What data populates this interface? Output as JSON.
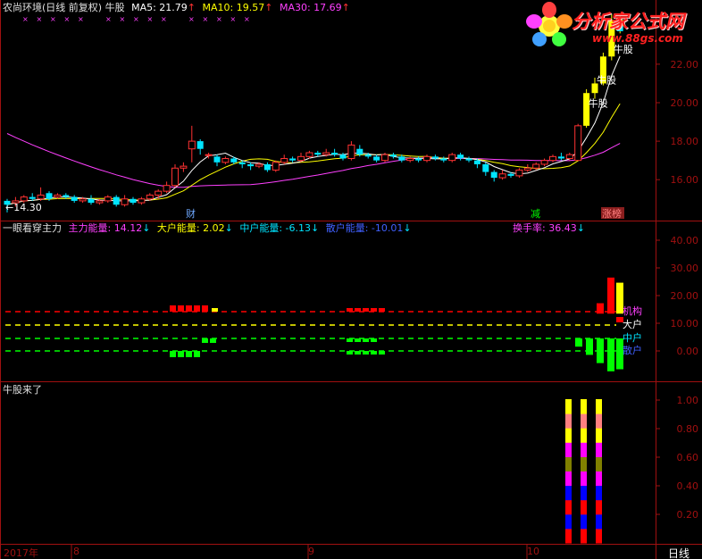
{
  "header": {
    "title": "农尚环境(日线 前复权) 牛股",
    "ma5": "MA5: 21.79",
    "ma10": "MA10: 19.57",
    "ma30": "MA30: 17.69",
    "arrow_up": "↑"
  },
  "indicator_header": {
    "name": "一眼看穿主力",
    "main": "主力能量: 14.12",
    "big": "大户能量: 2.02",
    "mid": "中户能量: -6.13",
    "retail": "散户能量: -10.01",
    "turnover": "换手率: 36.43",
    "arrow_down": "↓"
  },
  "signal_header": {
    "name": "牛股来了"
  },
  "logo": {
    "text": "分析家公式网",
    "url": "www.88gs.com"
  },
  "period_label": "日线",
  "time_axis": [
    {
      "label": "2017年"
    },
    {
      "label": "8"
    },
    {
      "label": "9"
    },
    {
      "label": "10"
    }
  ],
  "event_labels": [
    {
      "text": "财",
      "color": "#6fa8ff"
    },
    {
      "text": "减",
      "color": "#00ff00"
    },
    {
      "text": "涨榜",
      "color": "#ff8080",
      "bg": "#8a1e1e"
    }
  ],
  "price_labels": {
    "low_marker": "←14.30",
    "bull": "牛股"
  },
  "colors": {
    "up": "#ff3232",
    "down": "#00e4ff",
    "ma5": "#ffffff",
    "ma10": "#ffff00",
    "ma30": "#ff40ff",
    "axis": "#a01010",
    "bull_bar": "#ffff00"
  },
  "chart_data": [
    {
      "type": "candlestick",
      "title": "农尚环境(日线 前复权) 牛股",
      "ylim": [
        14.2,
        24.5
      ],
      "yticks": [
        "16.00",
        "18.00",
        "20.00",
        "22.00"
      ],
      "series": [
        {
          "name": "MA5",
          "value": 21.79
        },
        {
          "name": "MA10",
          "value": 19.57
        },
        {
          "name": "MA30",
          "value": 17.69
        }
      ],
      "candles": [
        [
          14.9,
          14.7,
          15.0,
          14.3
        ],
        [
          14.8,
          14.9,
          15.1,
          14.6
        ],
        [
          14.9,
          15.1,
          15.2,
          14.8
        ],
        [
          15.1,
          15.0,
          15.3,
          14.9
        ],
        [
          15.0,
          15.2,
          15.6,
          14.9
        ],
        [
          15.3,
          15.0,
          15.4,
          14.9
        ],
        [
          15.1,
          15.2,
          15.3,
          15.0
        ],
        [
          15.2,
          15.1,
          15.3,
          15.0
        ],
        [
          15.1,
          14.9,
          15.2,
          14.8
        ],
        [
          14.9,
          15.0,
          15.1,
          14.8
        ],
        [
          15.0,
          14.8,
          15.2,
          14.7
        ],
        [
          14.8,
          14.9,
          15.0,
          14.7
        ],
        [
          14.9,
          15.1,
          15.2,
          14.8
        ],
        [
          15.1,
          14.7,
          15.2,
          14.6
        ],
        [
          14.7,
          15.0,
          15.2,
          14.6
        ],
        [
          15.0,
          14.8,
          15.1,
          14.7
        ],
        [
          14.8,
          15.0,
          15.1,
          14.7
        ],
        [
          15.0,
          15.2,
          15.3,
          14.9
        ],
        [
          15.2,
          15.4,
          15.5,
          15.0
        ],
        [
          15.4,
          15.7,
          15.9,
          15.3
        ],
        [
          15.7,
          16.6,
          16.8,
          15.6
        ],
        [
          16.6,
          16.7,
          16.9,
          16.4
        ],
        [
          17.6,
          18.0,
          18.8,
          16.9
        ],
        [
          18.0,
          17.6,
          18.1,
          17.3
        ],
        [
          17.3,
          17.3,
          17.4,
          17.1
        ],
        [
          17.2,
          16.9,
          17.3,
          16.7
        ],
        [
          16.9,
          17.1,
          17.2,
          16.8
        ],
        [
          17.1,
          16.9,
          17.2,
          16.8
        ],
        [
          16.9,
          16.8,
          17.0,
          16.6
        ],
        [
          16.8,
          16.7,
          16.9,
          16.5
        ],
        [
          16.7,
          16.8,
          16.9,
          16.6
        ],
        [
          16.8,
          16.5,
          16.9,
          16.4
        ],
        [
          16.5,
          16.9,
          17.0,
          16.4
        ],
        [
          16.9,
          17.1,
          17.3,
          16.8
        ],
        [
          17.1,
          17.0,
          17.2,
          16.9
        ],
        [
          17.0,
          17.2,
          17.4,
          16.9
        ],
        [
          17.2,
          17.4,
          17.5,
          17.1
        ],
        [
          17.4,
          17.3,
          17.5,
          17.2
        ],
        [
          17.3,
          17.4,
          17.6,
          17.2
        ],
        [
          17.4,
          17.3,
          17.6,
          17.2
        ],
        [
          17.3,
          17.1,
          17.4,
          17.0
        ],
        [
          17.1,
          17.8,
          18.0,
          17.0
        ],
        [
          17.6,
          17.3,
          17.8,
          17.2
        ],
        [
          17.3,
          17.2,
          17.4,
          17.1
        ],
        [
          17.2,
          17.0,
          17.3,
          16.9
        ],
        [
          17.0,
          17.3,
          17.4,
          16.9
        ],
        [
          17.3,
          17.2,
          17.4,
          17.1
        ],
        [
          17.2,
          17.0,
          17.3,
          16.9
        ],
        [
          17.0,
          17.1,
          17.2,
          16.9
        ],
        [
          17.1,
          17.0,
          17.2,
          16.9
        ],
        [
          17.0,
          17.2,
          17.3,
          16.9
        ],
        [
          17.2,
          17.1,
          17.3,
          17.0
        ],
        [
          17.1,
          17.0,
          17.2,
          16.9
        ],
        [
          17.0,
          17.3,
          17.4,
          16.9
        ],
        [
          17.3,
          17.1,
          17.4,
          17.0
        ],
        [
          17.1,
          17.0,
          17.2,
          16.9
        ],
        [
          17.0,
          16.8,
          17.1,
          16.6
        ],
        [
          16.8,
          16.4,
          16.9,
          16.2
        ],
        [
          16.4,
          16.1,
          16.5,
          15.9
        ],
        [
          16.1,
          16.3,
          16.5,
          16.0
        ],
        [
          16.3,
          16.2,
          16.4,
          16.1
        ],
        [
          16.2,
          16.5,
          16.6,
          16.1
        ],
        [
          16.5,
          16.6,
          16.8,
          16.4
        ],
        [
          16.6,
          16.8,
          16.9,
          16.5
        ],
        [
          16.8,
          17.0,
          17.1,
          16.7
        ],
        [
          17.0,
          17.2,
          17.3,
          16.9
        ],
        [
          17.2,
          17.1,
          17.4,
          17.0
        ],
        [
          17.1,
          17.3,
          17.4,
          17.0
        ],
        [
          17.0,
          18.8,
          18.9,
          17.0
        ],
        [
          18.8,
          20.5,
          20.7,
          18.7
        ],
        [
          20.5,
          21.0,
          21.3,
          20.2
        ],
        [
          21.0,
          22.4,
          22.6,
          20.9
        ],
        [
          22.4,
          24.3,
          24.6,
          22.2
        ],
        [
          24.3,
          23.9,
          24.6,
          23.6
        ]
      ]
    },
    {
      "type": "bar",
      "title": "一眼看穿主力",
      "ylim": [
        -10,
        45
      ],
      "yticks": [
        "0.00",
        "10.00",
        "20.00",
        "30.00",
        "40.00"
      ],
      "series": [
        {
          "name": "主力能量",
          "value": 14.12
        },
        {
          "name": "大户能量",
          "value": 2.02
        },
        {
          "name": "中户能量",
          "value": -6.13
        },
        {
          "name": "散户能量",
          "value": -10.01
        },
        {
          "name": "换手率",
          "value": 36.43
        }
      ],
      "series_labels": [
        "机构",
        "大户",
        "中户",
        "散户"
      ],
      "series_colors": [
        "#ff40ff",
        "#ffffff",
        "#00e4ff",
        "#4060ff"
      ],
      "main": [
        0,
        0,
        0,
        0,
        0,
        0,
        0,
        0,
        0,
        0,
        0,
        0,
        0,
        0,
        0,
        0,
        0,
        0,
        0,
        0,
        0,
        0,
        0,
        0,
        0,
        0,
        0,
        0,
        0,
        0,
        0,
        0,
        0,
        0,
        0,
        0,
        0,
        0,
        0,
        0,
        0,
        0,
        0,
        0,
        0,
        0,
        0,
        0,
        0,
        0,
        0,
        0,
        0,
        0,
        0,
        0,
        0,
        0,
        0,
        0,
        0,
        0,
        0,
        0,
        0,
        0,
        0,
        0,
        0,
        0,
        0,
        0,
        0,
        0,
        0,
        0,
        0,
        0,
        0,
        0,
        0,
        0,
        0,
        0,
        0,
        0,
        0,
        0,
        0,
        0,
        0,
        0,
        0,
        0,
        0,
        0,
        0,
        0,
        0,
        0
      ]
    },
    {
      "type": "bar",
      "title": "牛股来了",
      "ylim": [
        0,
        1.1
      ],
      "yticks": [
        "0.20",
        "0.40",
        "0.60",
        "0.80",
        "1.00"
      ],
      "signal_bars": [
        1,
        1,
        1
      ],
      "stripe_colors": [
        "#ff0000",
        "#0000ff",
        "#ff0000",
        "#0000ff",
        "#ff00ff",
        "#808000",
        "#ff00ff",
        "#ffff00",
        "#ff8080",
        "#ffff00"
      ]
    }
  ]
}
